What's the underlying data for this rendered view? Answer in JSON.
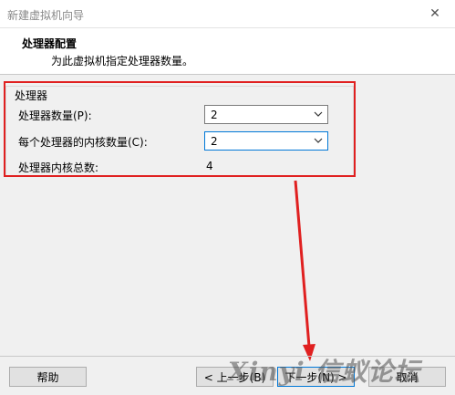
{
  "window": {
    "title": "新建虚拟机向导"
  },
  "header": {
    "title": "处理器配置",
    "subtitle": "为此虚拟机指定处理器数量。"
  },
  "processor_group": {
    "title": "处理器",
    "processor_count": {
      "label": "处理器数量(P):",
      "value": "2"
    },
    "cores_per_processor": {
      "label": "每个处理器的内核数量(C):",
      "value": "2"
    },
    "total_cores": {
      "label": "处理器内核总数:",
      "value": "4"
    }
  },
  "footer": {
    "help_label": "帮助",
    "back_label": "< 上一步(B)",
    "next_label": "下一步(N) >",
    "cancel_label": "取消"
  },
  "watermark": {
    "text": "Xinyi 信蚁论坛"
  },
  "annotation": {
    "color": "#e02020"
  },
  "icons": {
    "close": "close-icon",
    "dropdown": "chevron-down-icon"
  }
}
